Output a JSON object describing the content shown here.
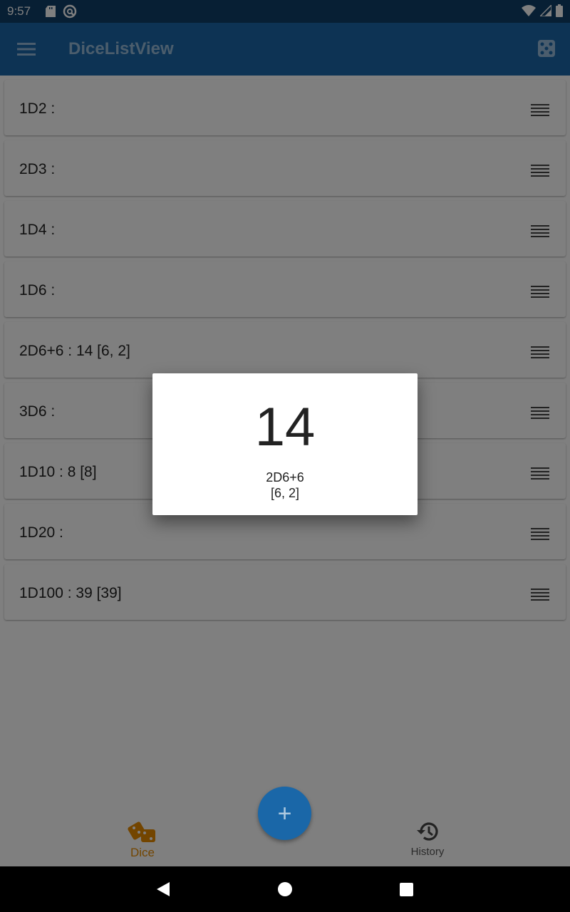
{
  "status_bar": {
    "time": "9:57"
  },
  "app_bar": {
    "title": "DiceListView"
  },
  "dice_list": [
    {
      "label": "1D2 :"
    },
    {
      "label": "2D3 :"
    },
    {
      "label": "1D4 :"
    },
    {
      "label": "1D6 :"
    },
    {
      "label": "2D6+6 : 14 [6, 2]"
    },
    {
      "label": "3D6 :"
    },
    {
      "label": "1D10 : 8 [8]"
    },
    {
      "label": "1D20 :"
    },
    {
      "label": "1D100 : 39 [39]"
    }
  ],
  "dialog": {
    "total": "14",
    "expression": "2D6+6",
    "rolls": "[6, 2]"
  },
  "fab": {
    "icon": "plus-icon",
    "label": "+"
  },
  "bottom_nav": {
    "dice_label": "Dice",
    "history_label": "History",
    "active_color": "#e68b00"
  },
  "colors": {
    "primary": "#1a67a8",
    "status_bar": "#0f3f68"
  }
}
